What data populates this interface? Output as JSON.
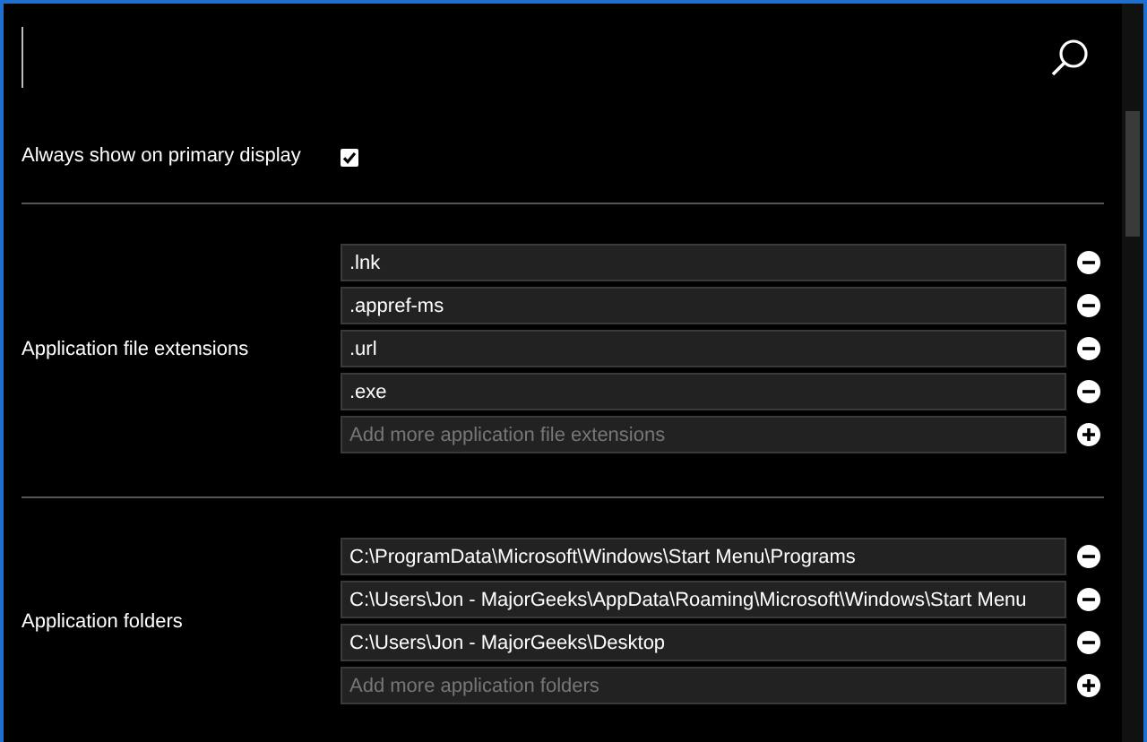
{
  "settings": [
    {
      "kind": "checkbox",
      "label": "Always show on primary display",
      "checked": true
    },
    {
      "kind": "list",
      "label": "Application file extensions",
      "items": [
        {
          "value": ".lnk"
        },
        {
          "value": ".appref-ms"
        },
        {
          "value": ".url"
        },
        {
          "value": ".exe"
        }
      ],
      "placeholder": "Add more application file extensions"
    },
    {
      "kind": "list",
      "label": "Application folders",
      "items": [
        {
          "value": "C:\\ProgramData\\Microsoft\\Windows\\Start Menu\\Programs"
        },
        {
          "value": "C:\\Users\\Jon - MajorGeeks\\AppData\\Roaming\\Microsoft\\Windows\\Start Menu"
        },
        {
          "value": "C:\\Users\\Jon - MajorGeeks\\Desktop"
        }
      ],
      "placeholder": "Add more application folders"
    }
  ]
}
